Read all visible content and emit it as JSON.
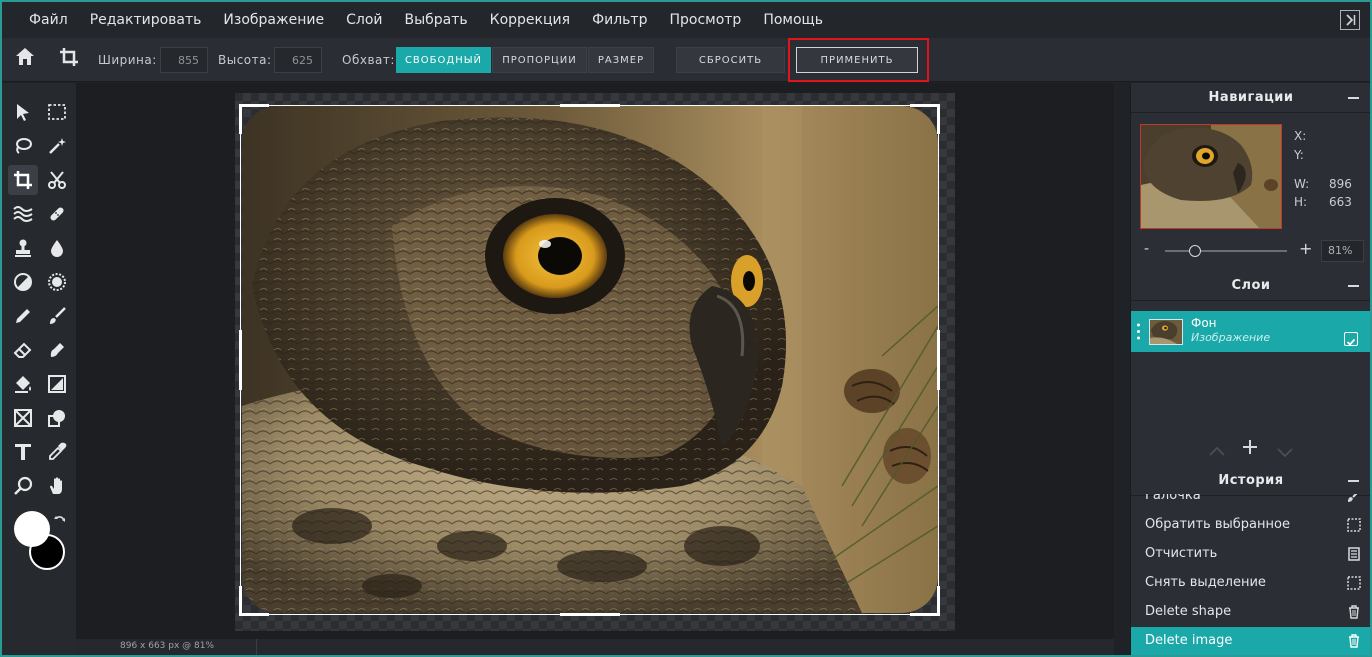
{
  "menu": [
    "Файл",
    "Редактировать",
    "Изображение",
    "Слой",
    "Выбрать",
    "Коррекция",
    "Фильтр",
    "Просмотр",
    "Помощь"
  ],
  "options": {
    "width_label": "Ширина:",
    "width_value": "855",
    "height_label": "Высота:",
    "height_value": "625",
    "scope_label": "Обхват:",
    "mode_free": "СВОБОДНЫЙ",
    "mode_proportions": "ПРОПОРЦИИ",
    "mode_size": "РАЗМЕР",
    "reset": "СБРОСИТЬ",
    "apply": "ПРИМЕНИТЬ",
    "highlight_color": "#e0141b"
  },
  "tools": [
    "pointer-icon",
    "marquee-icon",
    "lasso-icon",
    "magic-wand-icon",
    "crop-icon",
    "scissors-icon",
    "liquify-icon",
    "healing-bandage-icon",
    "stamp-icon",
    "blur-drop-icon",
    "dodge-burn-icon",
    "sponge-icon",
    "pencil-icon",
    "brush-icon",
    "eraser-icon",
    "smudge-icon",
    "bucket-fill-icon",
    "gradient-icon",
    "picture-frame-icon",
    "shape-icon",
    "text-icon",
    "eyedropper-icon",
    "zoom-icon",
    "hand-icon"
  ],
  "colors": {
    "foreground": "#ffffff",
    "background": "#000000",
    "accent": "#1aa8a8"
  },
  "status": {
    "text": "896 x 663 px @ 81%"
  },
  "navigator": {
    "title": "Навигации",
    "x_label": "X:",
    "y_label": "Y:",
    "w_label": "W:",
    "w_value": "896",
    "h_label": "H:",
    "h_value": "663",
    "zoom_minus": "-",
    "zoom_plus": "+",
    "zoom_value": "81%",
    "zoom_level": 0.81
  },
  "layers": {
    "title": "Слои",
    "items": [
      {
        "name": "Фон",
        "type": "Изображение",
        "visible": true
      }
    ]
  },
  "history": {
    "title": "История",
    "items": [
      {
        "label": "Галочка",
        "icon": "brush-icon"
      },
      {
        "label": "Обратить выбранное",
        "icon": "dashed-selection-icon"
      },
      {
        "label": "Отчистить",
        "icon": "document-icon"
      },
      {
        "label": "Снять выделение",
        "icon": "dashed-selection-icon"
      },
      {
        "label": "Delete shape",
        "icon": "trash-icon"
      },
      {
        "label": "Delete image",
        "icon": "trash-icon"
      }
    ]
  }
}
